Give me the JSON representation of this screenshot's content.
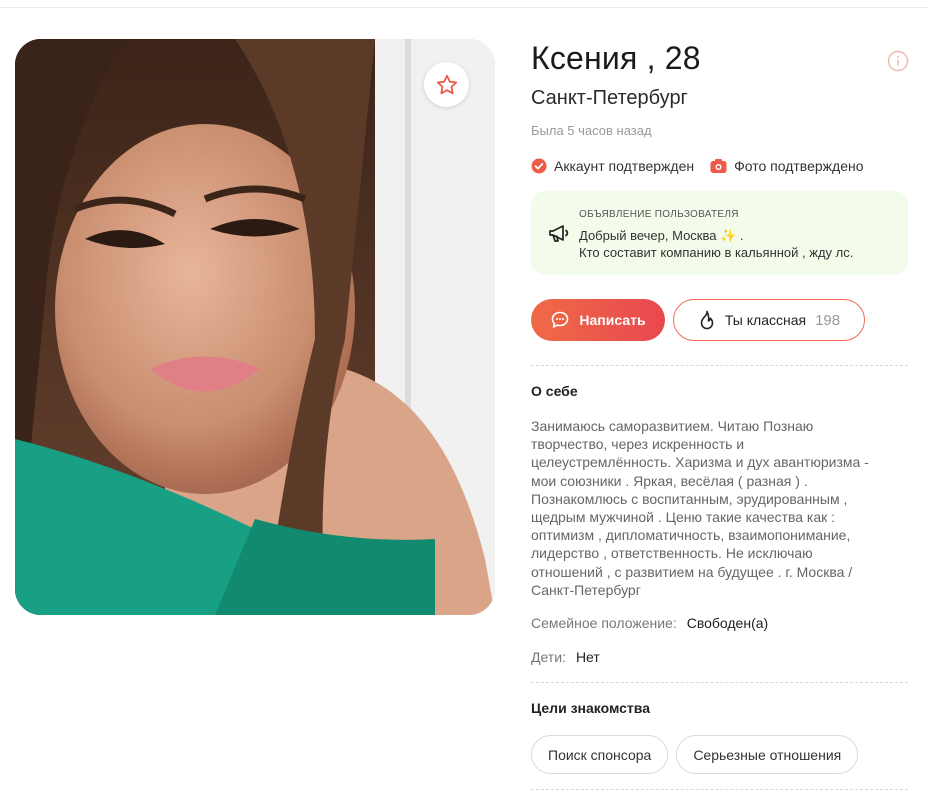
{
  "profile": {
    "name": "Ксения , 28",
    "city": "Санкт-Петербург",
    "last_seen": "Была 5 часов назад",
    "badges": {
      "account": "Аккаунт подтвержден",
      "photo": "Фото подтверждено"
    },
    "announcement": {
      "title": "ОБЪЯВЛЕНИЕ ПОЛЬЗОВАТЕЛЯ",
      "line1": "Добрый вечер, Москва ✨ .",
      "line2": "Кто составит компанию в кальянной , жду лс."
    },
    "actions": {
      "write_label": "Написать",
      "like_label": "Ты классная",
      "like_count": "198"
    },
    "about": {
      "title": "О себе",
      "lines": [
        "Занимаюсь саморазвитием. Читаю Познаю",
        "творчество, через искренность и",
        "целеустремлённость. Харизма и дух авантюризма -",
        "мои союзники . Яркая, весёлая ( разная ) .",
        "Познакомлюсь с воспитанным, эрудированным ,",
        "щедрым мужчиной . Ценю такие качества как :",
        "оптимизм , дипломатичность, взаимопонимание,",
        "лидерство , ответственность. Не исключаю",
        "отношений , с развитием на будущее . г. Москва /",
        "Санкт-Петербург"
      ]
    },
    "details": {
      "marital_label": "Семейное положение:",
      "marital_value": "Свободен(а)",
      "kids_label": "Дети:",
      "kids_value": "Нет"
    },
    "goals": {
      "title": "Цели знакомства",
      "items": [
        "Поиск спонсора",
        "Серьезные отношения"
      ]
    }
  },
  "icons": {
    "favorite": "star-icon",
    "info": "info-icon",
    "verified": "check-circle-icon",
    "photo_verified": "camera-icon",
    "announcement": "megaphone-icon",
    "message": "chat-bubble-icon",
    "like": "flame-icon"
  },
  "colors": {
    "accent": "#ee5a4a",
    "accent_gradient_start": "#f06a47",
    "announcement_bg": "#f3fbea",
    "muted_text": "#9a9a9a"
  }
}
